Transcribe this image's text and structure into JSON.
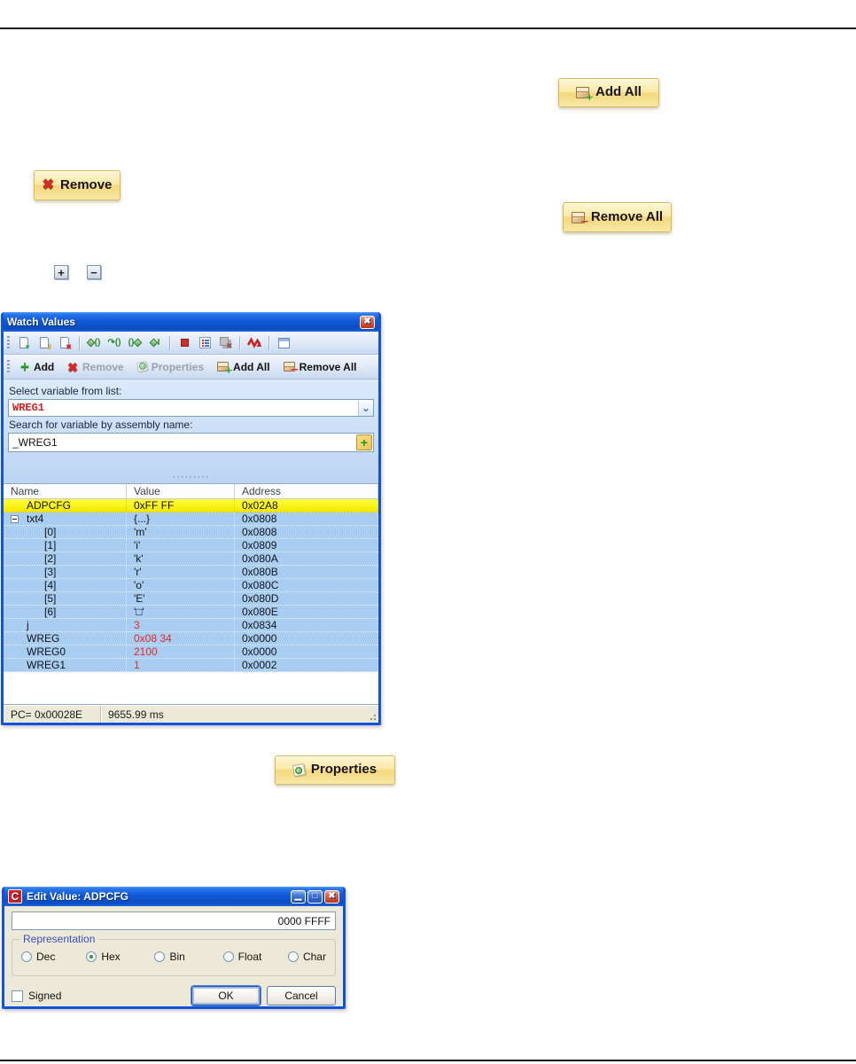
{
  "standalone_buttons": {
    "add_all_label": "Add All",
    "remove_label": "Remove",
    "remove_all_label": "Remove All",
    "properties_label": "Properties",
    "expand_glyph": "+",
    "collapse_glyph": "−"
  },
  "watch_window": {
    "title": "Watch Values",
    "toolbar_icons": [
      "copy-watch",
      "freeze-watch",
      "delete-watch",
      "step-into",
      "step-over",
      "step-out",
      "run-to-cursor",
      "stop",
      "watch-list",
      "clear-watch",
      "signal",
      "watch-window"
    ],
    "actions": [
      {
        "label": "Add",
        "icon": "green-plus",
        "enabled": true
      },
      {
        "label": "Remove",
        "icon": "red-x",
        "enabled": false
      },
      {
        "label": "Properties",
        "icon": "note",
        "enabled": false
      },
      {
        "label": "Add All",
        "icon": "box-plus",
        "enabled": true
      },
      {
        "label": "Remove All",
        "icon": "box-minus",
        "enabled": true
      }
    ],
    "select_label": "Select variable from list:",
    "select_value": "WREG1",
    "search_label": "Search for variable by assembly name:",
    "search_value": "_WREG1",
    "columns": [
      "Name",
      "Value",
      "Address"
    ],
    "rows": [
      {
        "name": "ADPCFG",
        "value": "0xFF FF",
        "address": "0x02A8",
        "indent": 1,
        "selected": true,
        "changed": false,
        "expander": false
      },
      {
        "name": "txt4",
        "value": "{...}",
        "address": "0x0808",
        "indent": 1,
        "selected": false,
        "changed": false,
        "expander": true
      },
      {
        "name": "[0]",
        "value": "'m'",
        "address": "0x0808",
        "indent": 2,
        "selected": false,
        "changed": false,
        "expander": false
      },
      {
        "name": "[1]",
        "value": "'i'",
        "address": "0x0809",
        "indent": 2,
        "selected": false,
        "changed": false,
        "expander": false
      },
      {
        "name": "[2]",
        "value": "'k'",
        "address": "0x080A",
        "indent": 2,
        "selected": false,
        "changed": false,
        "expander": false
      },
      {
        "name": "[3]",
        "value": "'r'",
        "address": "0x080B",
        "indent": 2,
        "selected": false,
        "changed": false,
        "expander": false
      },
      {
        "name": "[4]",
        "value": "'o'",
        "address": "0x080C",
        "indent": 2,
        "selected": false,
        "changed": false,
        "expander": false
      },
      {
        "name": "[5]",
        "value": "'E'",
        "address": "0x080D",
        "indent": 2,
        "selected": false,
        "changed": false,
        "expander": false
      },
      {
        "name": "[6]",
        "value": "'□'",
        "address": "0x080E",
        "indent": 2,
        "selected": false,
        "changed": false,
        "expander": false
      },
      {
        "name": "j",
        "value": "3",
        "address": "0x0834",
        "indent": 1,
        "selected": false,
        "changed": true,
        "expander": false
      },
      {
        "name": "WREG",
        "value": "0x08 34",
        "address": "0x0000",
        "indent": 1,
        "selected": false,
        "changed": true,
        "expander": false
      },
      {
        "name": "WREG0",
        "value": "2100",
        "address": "0x0000",
        "indent": 1,
        "selected": false,
        "changed": true,
        "expander": false
      },
      {
        "name": "WREG1",
        "value": "1",
        "address": "0x0002",
        "indent": 1,
        "selected": false,
        "changed": true,
        "expander": false
      }
    ],
    "status": {
      "pc": "PC= 0x00028E",
      "time": "9655.99 ms"
    }
  },
  "edit_dialog": {
    "title": "Edit Value: ADPCFG",
    "app_icon_letter": "C",
    "value": "0000 FFFF",
    "group_label": "Representation",
    "radios": [
      {
        "label": "Dec",
        "checked": false
      },
      {
        "label": "Hex",
        "checked": true
      },
      {
        "label": "Bin",
        "checked": false
      },
      {
        "label": "Float",
        "checked": false
      },
      {
        "label": "Char",
        "checked": false
      }
    ],
    "signed_label": "Signed",
    "ok_label": "OK",
    "cancel_label": "Cancel"
  },
  "colors": {
    "window_border_blue": "#1353d8",
    "row_blue": "#a9cdf1",
    "selected_yellow": "#ffff00",
    "changed_value_red": "#e02a2a",
    "doc_button_yellow": "#f4d87c"
  }
}
